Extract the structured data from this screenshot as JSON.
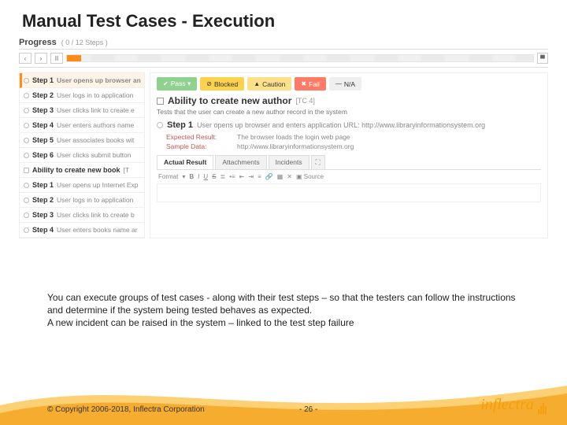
{
  "slide": {
    "title": "Manual Test Cases - Execution",
    "paragraph1": "You can execute groups of test cases - along with their test steps – so that the testers can follow the instructions and determine if the system being tested behaves as expected.",
    "paragraph2": "A new incident can be raised in the system – linked to the test step failure",
    "copyright": "© Copyright 2006-2018, Inflectra Corporation",
    "page": "- 26 -",
    "logo": "inflectra"
  },
  "progress": {
    "label": "Progress",
    "count": "( 0 / 12 Steps )"
  },
  "nav": {
    "prev": "‹",
    "next": "›",
    "pause": "II",
    "end": "▀"
  },
  "sidebar": [
    {
      "bold": "Step 1",
      "rest": "User opens up browser an",
      "active": true,
      "section": false
    },
    {
      "bold": "Step 2",
      "rest": "User logs in to application",
      "section": false
    },
    {
      "bold": "Step 3",
      "rest": "User clicks link to create e",
      "section": false
    },
    {
      "bold": "Step 4",
      "rest": "User enters authors name",
      "section": false
    },
    {
      "bold": "Step 5",
      "rest": "User associates books wit",
      "section": false
    },
    {
      "bold": "Step 6",
      "rest": "User clicks submit button",
      "section": false
    },
    {
      "bold": "Ability to create new book",
      "rest": "[T",
      "section": true
    },
    {
      "bold": "Step 1",
      "rest": "User opens up Internet Exp",
      "section": false
    },
    {
      "bold": "Step 2",
      "rest": "User logs in to application",
      "section": false
    },
    {
      "bold": "Step 3",
      "rest": "User clicks link to create b",
      "section": false
    },
    {
      "bold": "Step 4",
      "rest": "User enters books name ar",
      "section": false
    }
  ],
  "status": {
    "pass": "Pass ▾",
    "blocked": "Blocked",
    "caution": "Caution",
    "fail": "Fail",
    "na": "N/A"
  },
  "testcase": {
    "title": "Ability to create new author",
    "id": "[TC 4]",
    "desc": "Tests that the user can create a new author record in the system",
    "step_label": "Step 1",
    "step_text": "User opens up browser and enters application URL: http://www.libraryinformationsystem.org",
    "expected_k": "Expected Result:",
    "expected_v": "The browser loads the login web page",
    "sample_k": "Sample Data:",
    "sample_v": "http://www.libraryinformationsystem.org"
  },
  "tabs": {
    "actual": "Actual Result",
    "attach": "Attachments",
    "inc": "Incidents",
    "exp": "⛶"
  },
  "editor": {
    "format": "Format",
    "source": "Source"
  }
}
